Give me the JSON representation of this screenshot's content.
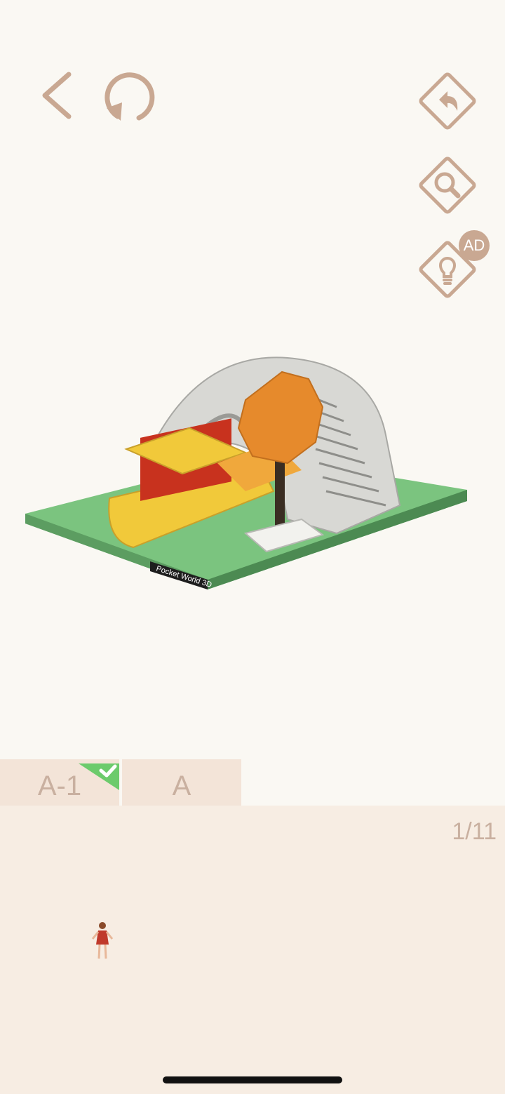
{
  "toolbar": {
    "back_icon": "chevron-left-icon",
    "restart_icon": "restart-icon",
    "undo_icon": "undo-icon",
    "zoom_icon": "magnifier-icon",
    "hint_icon": "lightbulb-icon",
    "hint_badge": "AD"
  },
  "scene": {
    "watermark": "Pocket World 3D"
  },
  "tabs": [
    {
      "label": "A-1",
      "completed": true
    },
    {
      "label": "A",
      "completed": false
    }
  ],
  "tray": {
    "page_counter": "1/11"
  },
  "colors": {
    "accent": "#c9a892",
    "background": "#faf8f3",
    "tray": "#f7ede3",
    "tab": "#f3e4d8",
    "check": "#6ccb6c"
  }
}
